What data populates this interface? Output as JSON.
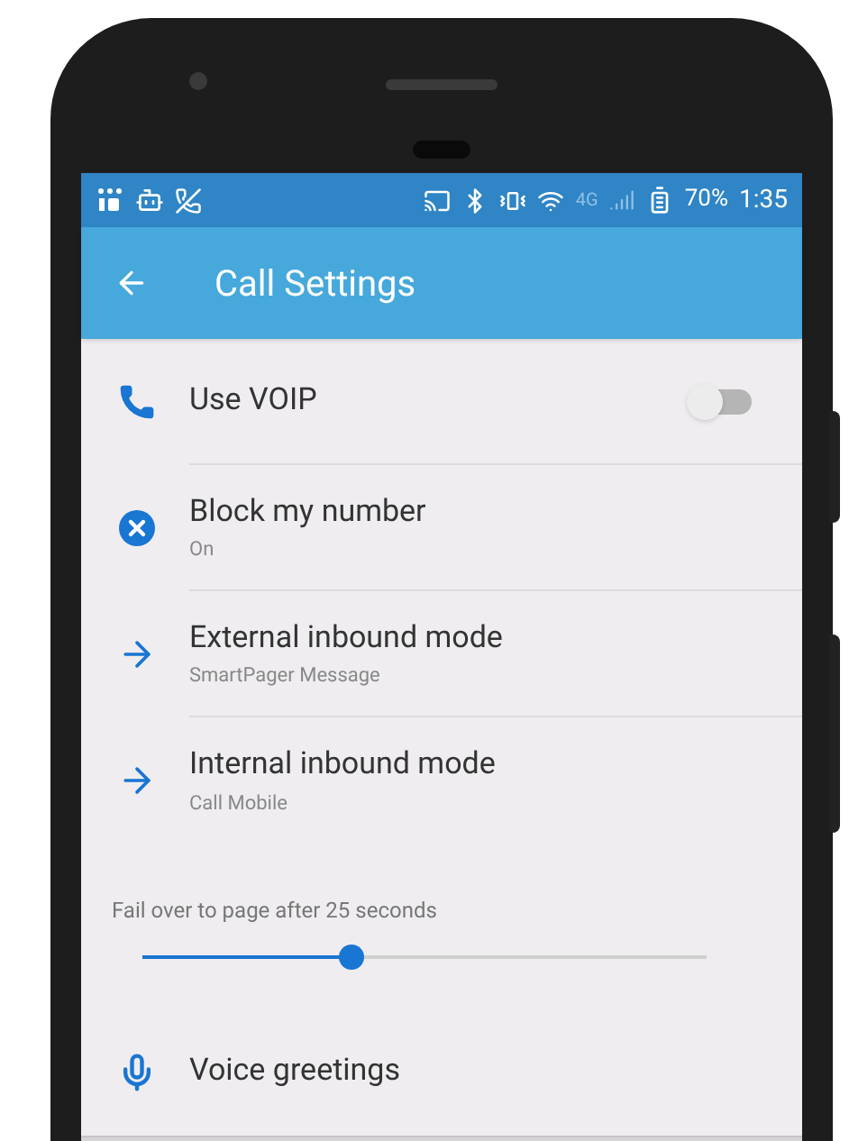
{
  "status_bar": {
    "network": "4G",
    "battery": "70%",
    "time": "1:35"
  },
  "app_bar": {
    "title": "Call Settings"
  },
  "settings": [
    {
      "kind": "toggle",
      "title": "Use VOIP",
      "on": false
    },
    {
      "kind": "link",
      "title": "Block my number",
      "subtitle": "On"
    },
    {
      "kind": "link",
      "title": "External inbound mode",
      "subtitle": "SmartPager Message"
    },
    {
      "kind": "link",
      "title": "Internal inbound mode",
      "subtitle": "Call Mobile"
    },
    {
      "kind": "slider",
      "label": "Fail over to page after 25 seconds",
      "level": 0.37
    },
    {
      "kind": "link",
      "title": "Voice greetings"
    }
  ]
}
